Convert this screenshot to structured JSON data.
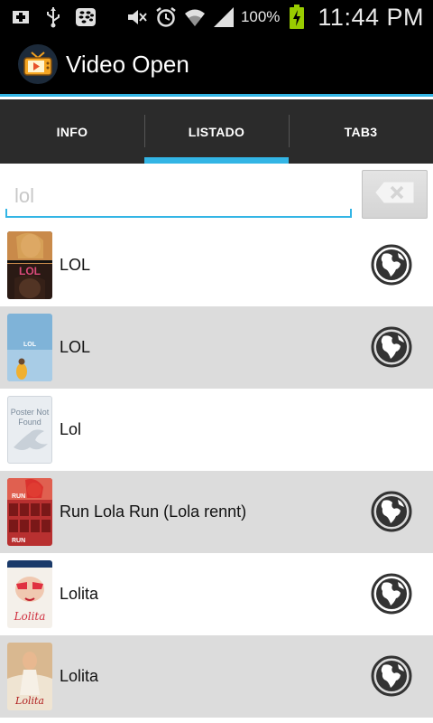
{
  "status_bar": {
    "battery_percent": "100%",
    "time": "11:44 PM",
    "icons": [
      "add-icon",
      "usb-icon",
      "blackberry-icon",
      "mute-icon",
      "alarm-icon",
      "wifi-icon",
      "signal-icon",
      "battery-charging-icon"
    ]
  },
  "action_bar": {
    "title": "Video Open",
    "icon": "tv-icon"
  },
  "tabs": [
    {
      "label": "INFO",
      "active": false
    },
    {
      "label": "LISTADO",
      "active": true
    },
    {
      "label": "TAB3",
      "active": false
    }
  ],
  "search": {
    "value": "lol",
    "clear_icon": "backspace-clear-icon"
  },
  "results": [
    {
      "title": "LOL",
      "poster": "lol-2012-poster",
      "has_globe": true
    },
    {
      "title": "LOL",
      "poster": "lol-french-poster",
      "has_globe": true
    },
    {
      "title": "Lol",
      "poster": "poster-not-found",
      "poster_text": "Poster Not Found",
      "has_globe": false
    },
    {
      "title": "Run Lola Run (Lola rennt)",
      "poster": "run-lola-run-poster",
      "has_globe": true
    },
    {
      "title": "Lolita",
      "poster": "lolita-1962-poster",
      "has_globe": true
    },
    {
      "title": "Lolita",
      "poster": "lolita-1997-poster",
      "has_globe": true
    }
  ],
  "colors": {
    "accent": "#33b5e5",
    "row_alt": "#dcdcdc",
    "tab_bg": "#2b2b2b"
  }
}
